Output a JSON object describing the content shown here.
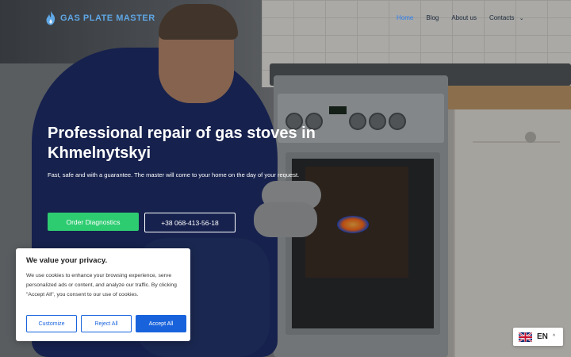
{
  "brand": {
    "name": "GAS PLATE MASTER",
    "color": "#5fa7e6"
  },
  "nav": {
    "items": [
      {
        "label": "Home",
        "active": true
      },
      {
        "label": "Blog",
        "active": false
      },
      {
        "label": "About us",
        "active": false
      },
      {
        "label": "Contacts",
        "active": false,
        "has_dropdown": true
      }
    ]
  },
  "hero": {
    "title": "Professional repair of gas stoves in Khmelnytskyi",
    "subtitle": "Fast, safe and with a guarantee. The master will come to your home on the day of your request.",
    "primary_button": "Order Diagnostics",
    "phone_button": "+38 068-413-56-18",
    "primary_color": "#2ecc71"
  },
  "cookie_banner": {
    "title": "We value your privacy.",
    "text": "We use cookies to enhance your browsing experience, serve personalized ads or content, and analyze our traffic. By clicking \"Accept All\", you consent to our use of cookies.",
    "customize_label": "Customize",
    "reject_label": "Reject All",
    "accept_label": "Accept All",
    "accent_color": "#1863dc"
  },
  "language_switcher": {
    "code": "EN",
    "flag": "uk-flag-icon"
  }
}
